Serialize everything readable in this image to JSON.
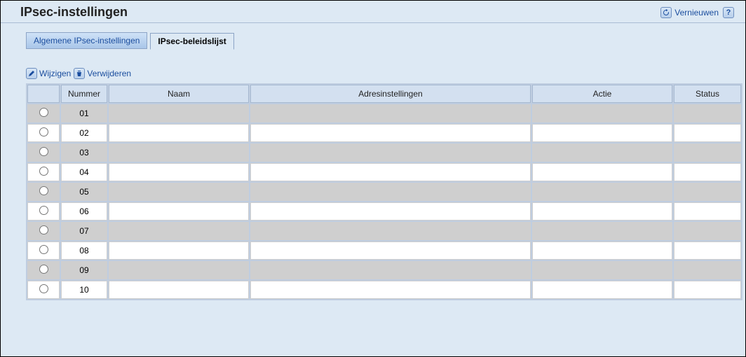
{
  "header": {
    "title": "IPsec-instellingen",
    "refresh_label": "Vernieuwen"
  },
  "tabs": [
    {
      "label": "Algemene IPsec-instellingen",
      "active": false
    },
    {
      "label": "IPsec-beleidslijst",
      "active": true
    }
  ],
  "toolbar": {
    "edit_label": "Wijzigen",
    "delete_label": "Verwijderen"
  },
  "table": {
    "columns": {
      "select": "",
      "number": "Nummer",
      "name": "Naam",
      "address": "Adresinstellingen",
      "action": "Actie",
      "status": "Status"
    },
    "rows": [
      {
        "number": "01",
        "name": "",
        "address": "",
        "action": "",
        "status": ""
      },
      {
        "number": "02",
        "name": "",
        "address": "",
        "action": "",
        "status": ""
      },
      {
        "number": "03",
        "name": "",
        "address": "",
        "action": "",
        "status": ""
      },
      {
        "number": "04",
        "name": "",
        "address": "",
        "action": "",
        "status": ""
      },
      {
        "number": "05",
        "name": "",
        "address": "",
        "action": "",
        "status": ""
      },
      {
        "number": "06",
        "name": "",
        "address": "",
        "action": "",
        "status": ""
      },
      {
        "number": "07",
        "name": "",
        "address": "",
        "action": "",
        "status": ""
      },
      {
        "number": "08",
        "name": "",
        "address": "",
        "action": "",
        "status": ""
      },
      {
        "number": "09",
        "name": "",
        "address": "",
        "action": "",
        "status": ""
      },
      {
        "number": "10",
        "name": "",
        "address": "",
        "action": "",
        "status": ""
      }
    ]
  }
}
